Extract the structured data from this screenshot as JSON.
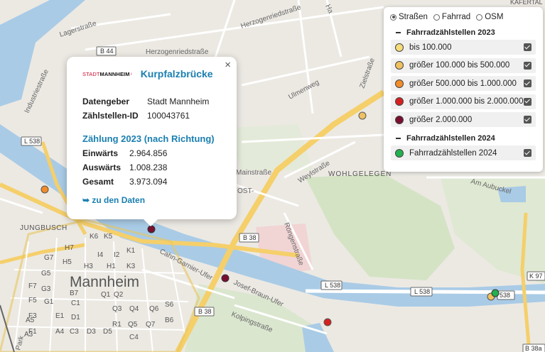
{
  "map": {
    "labels": {
      "lagerstrasse": "Lagerstraße",
      "herzogenriedstrasse_top": "Herzogenriedstraße",
      "herzogenriedstrasse": "Herzogenriedstraße",
      "industriestrasse": "Industriestraße",
      "ulmenweg": "Ulmenweg",
      "zielstrasse": "Zielstraße",
      "weylstrasse": "Weylstraße",
      "wohlgelegen": "WOHLGELEGEN",
      "mainstrasse": "Mainstraße",
      "jungbusch": "JUNGBUSCH",
      "mannheim": "Mannheim",
      "cahn_garnier": "Cahn-Garnier-Ufer",
      "josef_braun": "Josef-Braun-Ufer",
      "kolpingstrasse": "Kolpingstraße",
      "rongenstrasse": "Röngenstraße",
      "am_aubuckel": "Am Aubuckel",
      "kafertal": "KÄFERTAL",
      "park": "Park",
      "hafen": "Ha",
      "ost": "OST-"
    },
    "shields": {
      "b44": "B 44",
      "l538_left": "L 538",
      "b38_mid": "B 38",
      "b38_low": "B 38",
      "l538_right": "L 538",
      "l538_mid": "L 538",
      "l538_far": "538",
      "k97": "K 97",
      "b38a": "B 38a"
    },
    "grid": [
      "H7",
      "K6",
      "K5",
      "I4",
      "I2",
      "K1",
      "H5",
      "H3",
      "K3",
      "H1",
      "G7",
      "G5",
      "G3",
      "G1",
      "F7",
      "F5",
      "F3",
      "F1",
      "E1",
      "A5",
      "A3",
      "B7",
      "C1",
      "D1",
      "C3",
      "D3",
      "D5",
      "Q1",
      "Q2",
      "Q3",
      "Q4",
      "Q5",
      "Q6",
      "Q7",
      "R1",
      "S6",
      "A4",
      "B6",
      "C4"
    ]
  },
  "popup": {
    "logo_prefix": "STADT",
    "logo_name": "MANNHEIM",
    "logo_mark": "²",
    "title": "Kurpfalzbrücke",
    "datengeber_label": "Datengeber",
    "datengeber_value": "Stadt Mannheim",
    "id_label": "Zählstellen-ID",
    "id_value": "100043761",
    "section": "Zählung 2023 (nach Richtung)",
    "einwaerts_label": "Einwärts",
    "einwaerts_value": "2.964.856",
    "auswaerts_label": "Auswärts",
    "auswaerts_value": "1.008.238",
    "gesamt_label": "Gesamt",
    "gesamt_value": "3.973.094",
    "link": "➥ zu den Daten",
    "close": "×"
  },
  "panel": {
    "basemaps": [
      {
        "label": "Straßen",
        "selected": true
      },
      {
        "label": "Fahrrad",
        "selected": false
      },
      {
        "label": "OSM",
        "selected": false
      }
    ],
    "group_2023": "Fahrradzählstellen 2023",
    "group_2024": "Fahrradzählstellen 2024",
    "layers_2023": [
      {
        "label": "bis 100.000",
        "color": "#f6dc7a"
      },
      {
        "label": "größer 100.000 bis 500.000",
        "color": "#f0c060"
      },
      {
        "label": "größer 500.000 bis 1.000.000",
        "color": "#f28c2a"
      },
      {
        "label": "größer 1.000.000 bis 2.000.000",
        "color": "#d62020"
      },
      {
        "label": "größer 2.000.000",
        "color": "#7a1030"
      }
    ],
    "layers_2024": [
      {
        "label": "Fahrradzählstellen 2024",
        "color": "#22b050"
      }
    ]
  }
}
